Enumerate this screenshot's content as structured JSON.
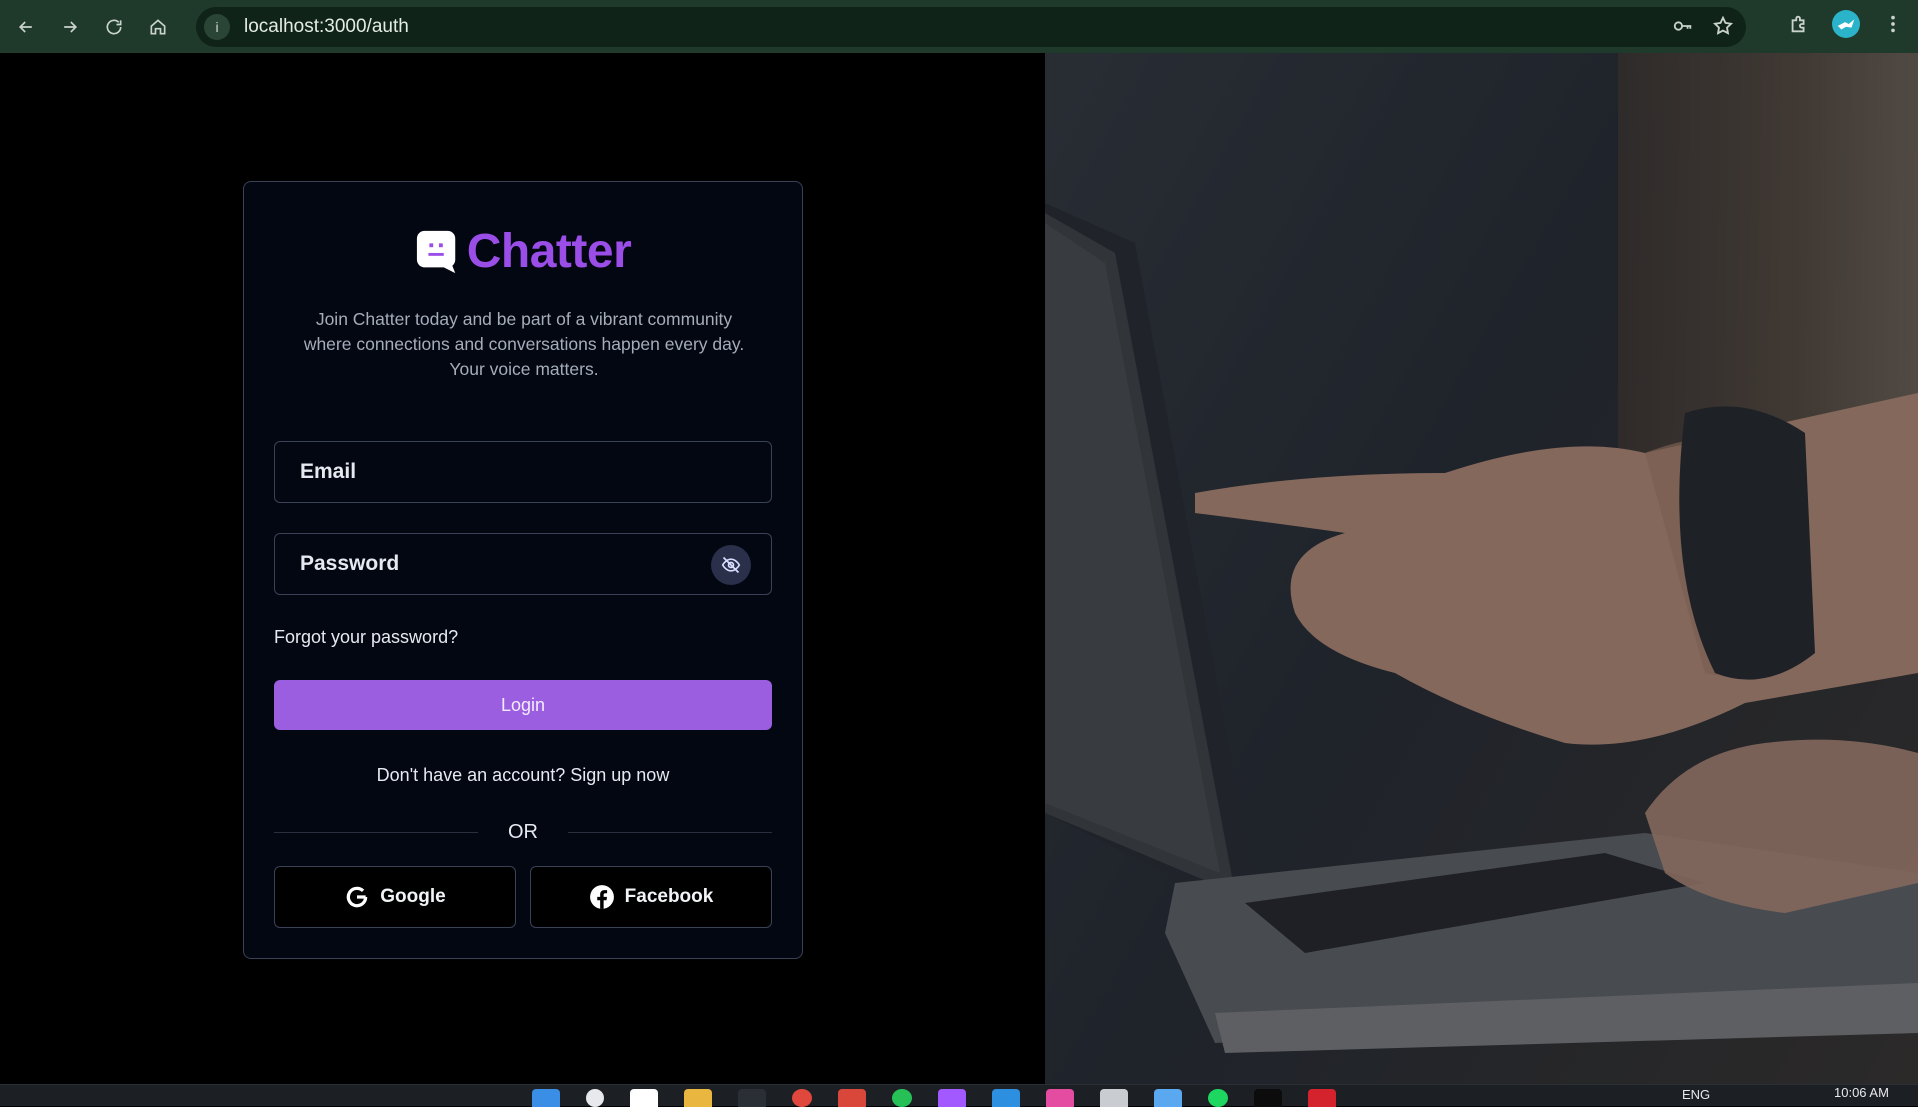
{
  "browser": {
    "url": "localhost:3000/auth"
  },
  "brand": {
    "name": "Chatter",
    "accent_color": "#9b4de8"
  },
  "tagline": {
    "line1": "Join Chatter today and be part of a vibrant community",
    "line2": "where connections and conversations happen every day.",
    "line3": "Your voice matters."
  },
  "form": {
    "email_placeholder": "Email",
    "password_placeholder": "Password",
    "forgot_label": "Forgot your password?",
    "login_label": "Login",
    "login_color": "#9b5ee0",
    "signup_label": "Don't have an account? Sign up now",
    "or_label": "OR"
  },
  "social": {
    "google_label": "Google",
    "facebook_label": "Facebook"
  },
  "icons": {
    "back": "arrow-left-icon",
    "forward": "arrow-right-icon",
    "reload": "reload-icon",
    "home": "home-icon",
    "info": "info-icon",
    "password_manager": "key-icon",
    "bookmark": "star-icon",
    "extensions": "puzzle-icon",
    "menu": "kebab-menu-icon",
    "password_toggle": "eye-off-icon"
  },
  "taskbar": {
    "language": "ENG",
    "time": "10:06 AM"
  }
}
